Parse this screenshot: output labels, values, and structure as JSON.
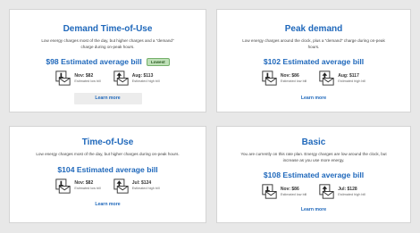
{
  "cards": [
    {
      "title": "Demand Time-of-Use",
      "description": "Low energy charges most of the day, but higher charges and a \"demand\" charge during on-peak hours.",
      "price": "$98 Estimated average bill",
      "badge": "Lowest",
      "low_bill": {
        "amount": "Nov: $82",
        "caption": "Estimated low bill",
        "icon": "bill-down-arrow-icon"
      },
      "high_bill": {
        "amount": "Aug: $113",
        "caption": "Estimated high bill",
        "icon": "bill-up-arrow-icon"
      },
      "link": "Learn more"
    },
    {
      "title": "Peak demand",
      "description": "Low energy charges around the clock, plus a \"demand\" charge during on-peak hours.",
      "price": "$102 Estimated average bill",
      "low_bill": {
        "amount": "Nov: $86",
        "caption": "Estimated low bill",
        "icon": "bill-down-arrow-icon"
      },
      "high_bill": {
        "amount": "Aug: $117",
        "caption": "Estimated high bill",
        "icon": "bill-up-arrow-icon"
      },
      "link": "Learn more"
    },
    {
      "title": "Time-of-Use",
      "description": "Low energy charges most of the day, but higher charges during on-peak hours.",
      "price": "$104 Estimated average bill",
      "low_bill": {
        "amount": "Nov: $82",
        "caption": "Estimated low bill",
        "icon": "bill-down-arrow-icon"
      },
      "high_bill": {
        "amount": "Jul: $124",
        "caption": "Estimated high bill",
        "icon": "bill-up-arrow-icon"
      },
      "link": "Learn more"
    },
    {
      "title": "Basic",
      "description": "You are currently on this rate plan. Energy charges are low around the clock, but increase as you use more energy.",
      "price": "$108 Estimated average bill",
      "low_bill": {
        "amount": "Nov: $86",
        "caption": "Estimated low bill",
        "icon": "bill-down-arrow-icon"
      },
      "high_bill": {
        "amount": "Jul: $128",
        "caption": "Estimated high bill",
        "icon": "bill-up-arrow-icon"
      },
      "link": "Learn more"
    }
  ],
  "colors": {
    "accent": "#1f68bb",
    "badge_bg": "#bfe0b8",
    "badge_border": "#75b06a",
    "background": "#e8e8e8"
  }
}
